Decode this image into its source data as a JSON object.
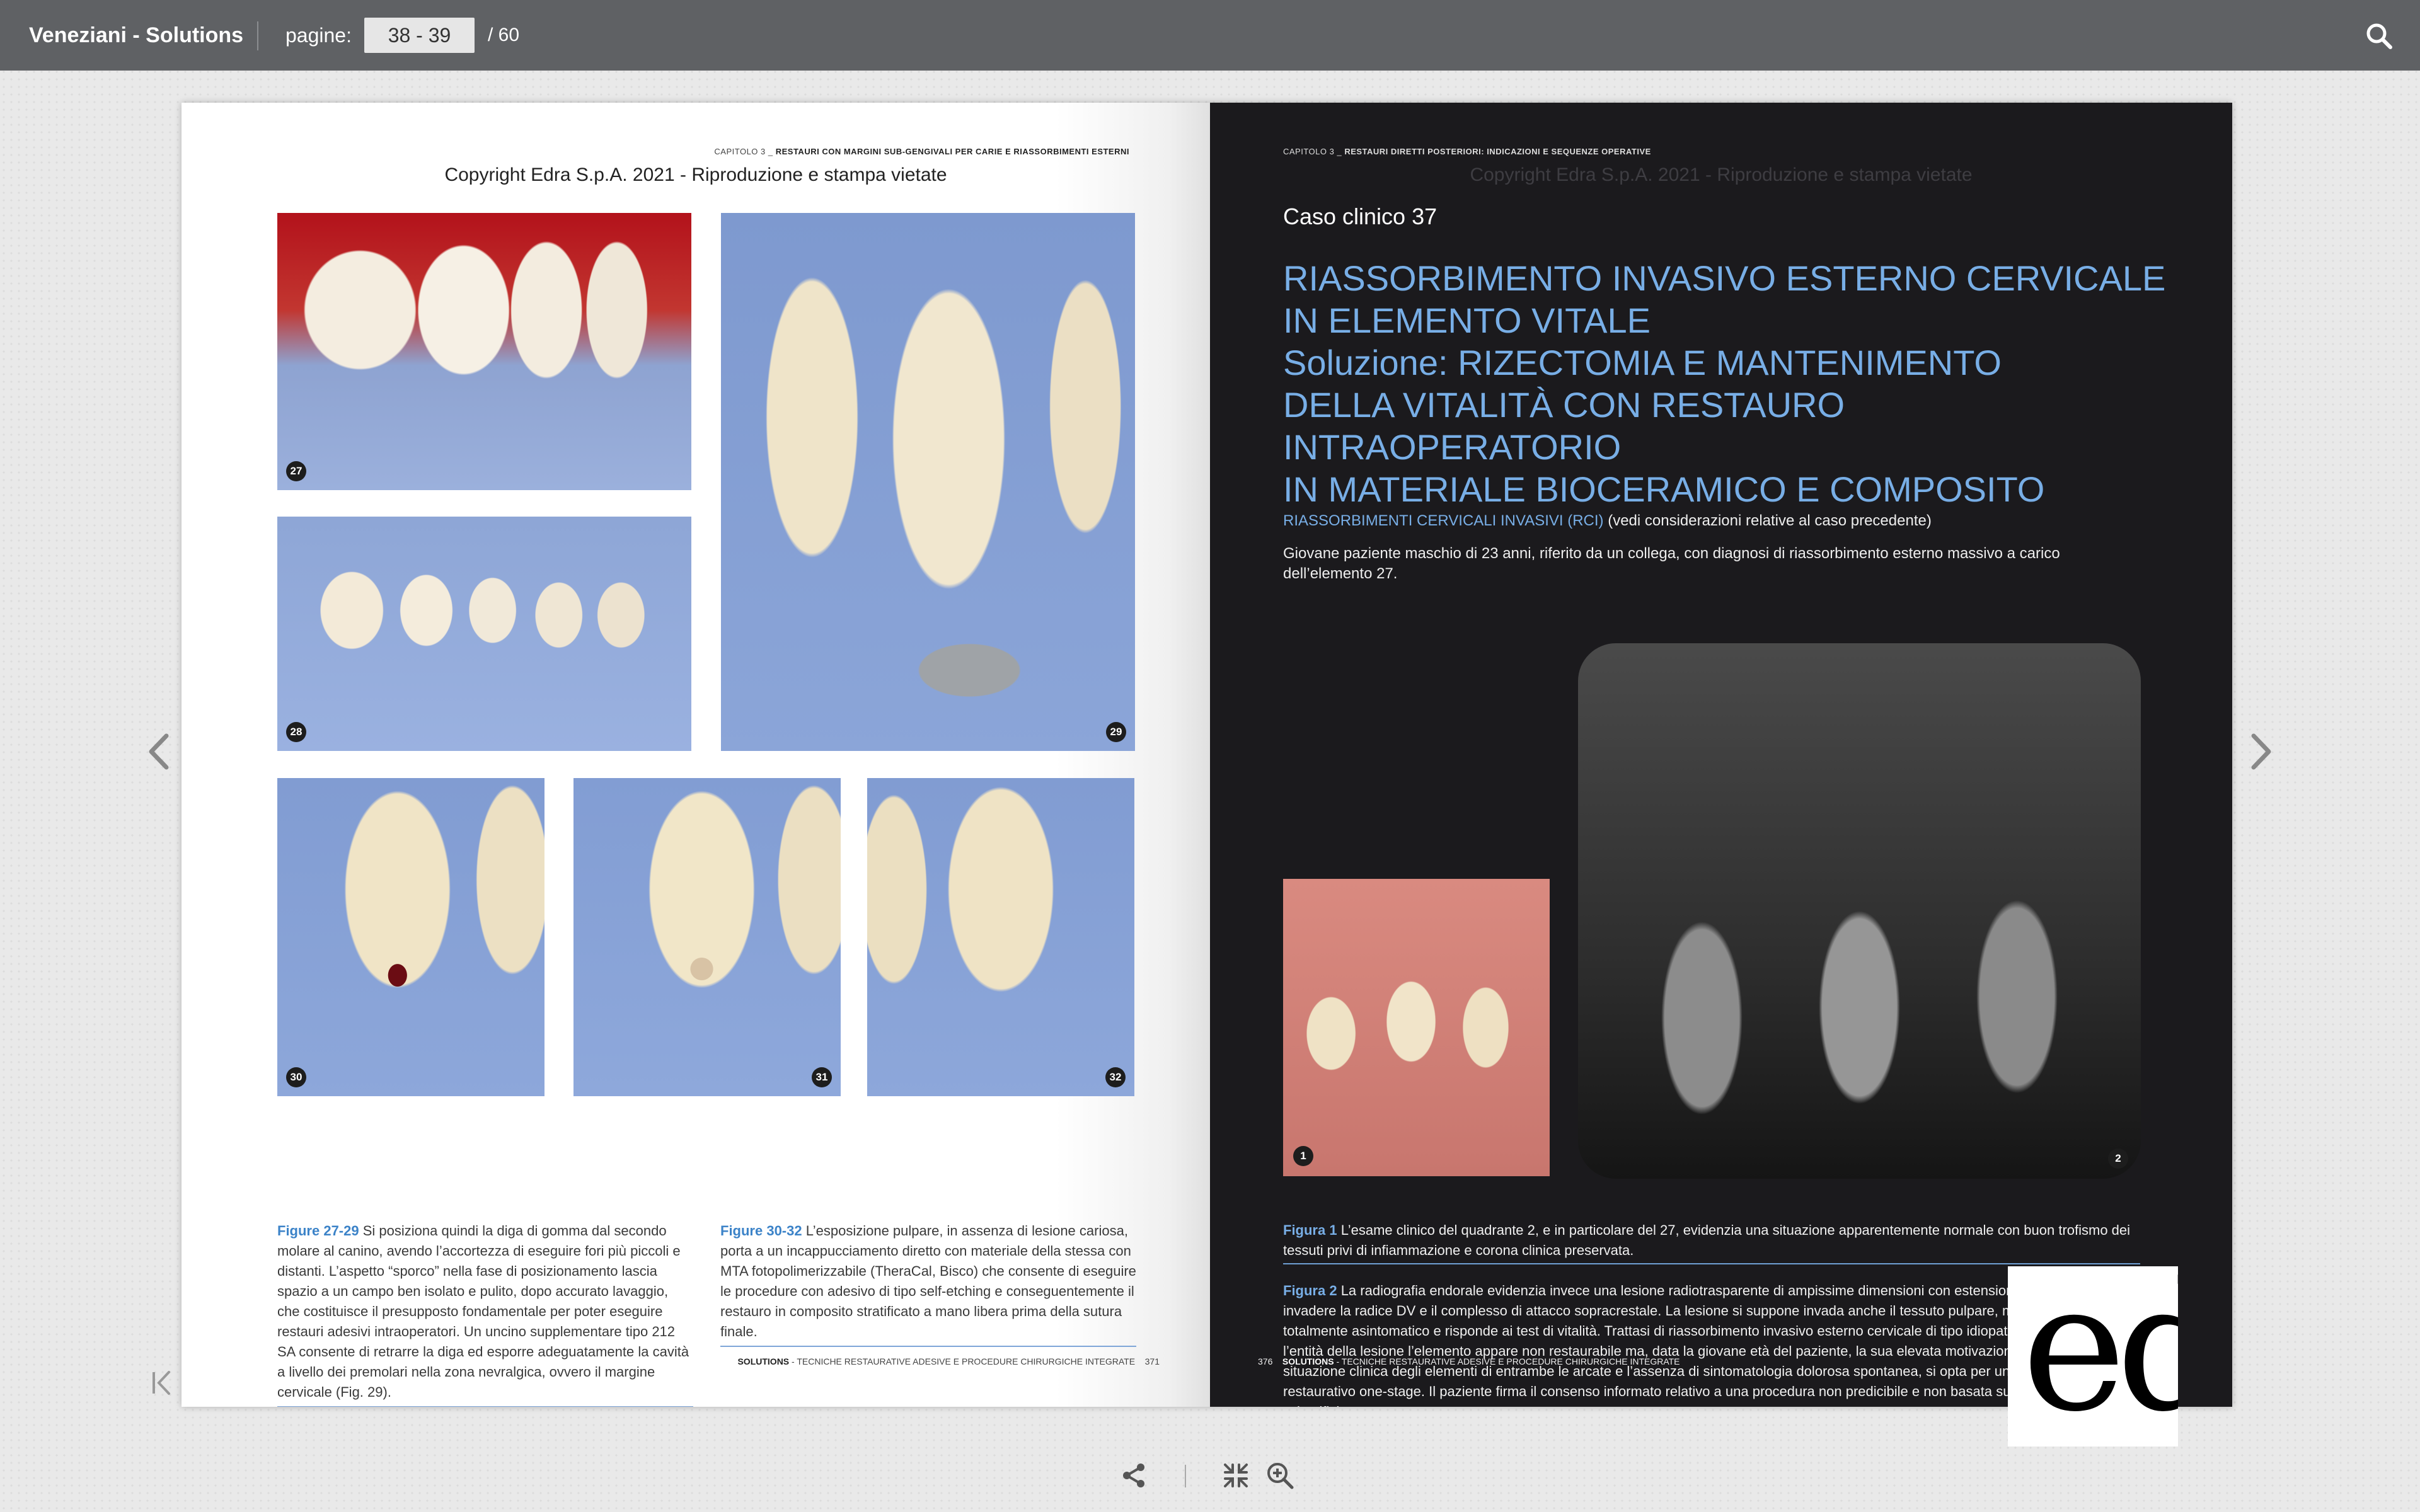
{
  "header": {
    "title": "Veneziani - Solutions",
    "pages_label": "pagine:",
    "pages_value": "38 - 39",
    "pages_total": "/ 60",
    "search_icon": "search-icon"
  },
  "left_page": {
    "running_head_chapter": "CAPITOLO 3 _",
    "running_head_title": "RESTAURI CON MARGINI SUB-GENGIVALI PER CARIE E RIASSORBIMENTI ESTERNI",
    "copyright": "Copyright Edra S.p.A. 2021 - Riproduzione e stampa vietate",
    "figure_numbers": [
      "27",
      "28",
      "29",
      "30",
      "31",
      "32"
    ],
    "caption1_label": "Figure 27-29",
    "caption1_text": " Si posiziona quindi la diga di gomma dal secondo molare al canino, avendo l’accortezza di eseguire fori più piccoli e distanti. L’aspetto “sporco” nella fase di posizionamento lascia spazio a un campo ben isolato e pulito, dopo accurato lavaggio, che costituisce il presupposto fondamentale per poter eseguire restauri adesivi intraoperatori. Un uncino supplementare tipo 212 SA consente di retrarre la diga ed esporre adeguatamente la cavità a livello dei premolari nella zona nevralgica, ovvero il margine cervicale (Fig. 29).",
    "caption2_label": "Figure 30-32",
    "caption2_text": " L’esposizione pulpare, in assenza di lesione cariosa, porta a un incappucciamento diretto con materiale della stessa con MTA fotopolimerizzabile (TheraCal, Bisco) che consente di eseguire le procedure con adesivo di tipo self-etching e conseguentemente il restauro in composito stratificato a mano libera prima della sutura finale.",
    "footer_book": "SOLUTIONS",
    "footer_subtitle": " - TECNICHE RESTAURATIVE ADESIVE E PROCEDURE CHIRURGICHE INTEGRATE",
    "page_number": "371"
  },
  "right_page": {
    "running_head_chapter": "CAPITOLO 3 _",
    "running_head_title": "RESTAURI DIRETTI POSTERIORI: INDICAZIONI E SEQUENZE OPERATIVE",
    "copyright": "Copyright Edra S.p.A. 2021 - Riproduzione e stampa vietate",
    "case_title": "Caso clinico 37",
    "title_line1": "RIASSORBIMENTO INVASIVO ESTERNO CERVICALE",
    "title_line2": "IN ELEMENTO VITALE",
    "title_line3": "Soluzione: RIZECTOMIA E MANTENIMENTO",
    "title_line4": "DELLA VITALITÀ CON RESTAURO INTRAOPERATORIO",
    "title_line5": "IN MATERIALE BIOCERAMICO E COMPOSITO",
    "section_highlight": "RIASSORBIMENTI CERVICALI INVASIVI (RCI)",
    "section_rest": " (vedi considerazioni relative al caso precedente)",
    "intro_text": "Giovane paziente maschio di 23 anni, riferito da un collega, con diagnosi di riassorbimento esterno massivo a carico dell’elemento 27.",
    "figure_numbers": [
      "1",
      "2"
    ],
    "fig1_label": "Figura 1",
    "fig1_text": " L’esame clinico del quadrante 2, e in particolare del 27, evidenzia una situazione apparentemente normale con buon trofismo dei tessuti privi di infiammazione e corona clinica preservata.",
    "fig2_label": "Figura 2",
    "fig2_text": " La radiografia endorale evidenzia invece una lesione radiotrasparente di ampissime dimensioni con estensione corono-apicale a invadere la radice DV e il complesso di attacco sopracrestale. La lesione si suppone invada anche il tessuto pulpare, ma l’elemento è totalmente asintomatico e risponde ai test di vitalità. Trattasi di riassorbimento invasivo esterno cervicale di tipo idiopatico. Considerando l’entità della lesione l’elemento appare non restaurabile ma, data la giovane età del paziente, la sua elevata motivazione, la buona situazione clinica degli elementi di entrambe le arcate e l’assenza di sintomatologia dolorosa spontanea, si opta per un approccio chirurgico restaurativo one-stage. Il paziente firma il consenso informato relativo a una procedura non predicibile e non basata su evidenze scientifiche.",
    "page_number": "376",
    "footer_book": "SOLUTIONS",
    "footer_subtitle": " - TECNICHE RESTAURATIVE ADESIVE E PROCEDURE CHIRURGICHE INTEGRATE"
  },
  "logo": {
    "text": "edra"
  },
  "navigation": {
    "prev_icon": "chevron-left-icon",
    "next_icon": "chevron-right-icon",
    "first_icon": "first-page-icon",
    "share_icon": "share-icon",
    "exit_fullscreen_icon": "collapse-icon",
    "zoom_icon": "zoom-in-icon"
  },
  "colors": {
    "topbar": "#5f6164",
    "accent_blue": "#78aee6",
    "right_page_bg": "#1b1a1d"
  }
}
